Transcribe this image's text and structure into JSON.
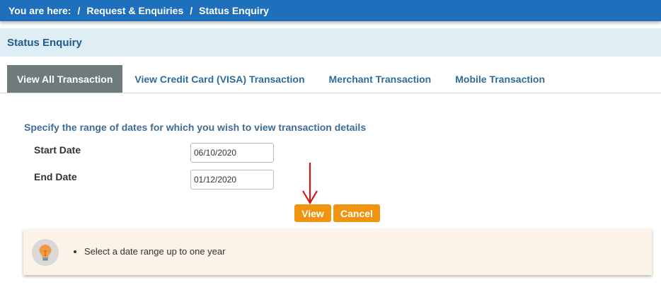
{
  "breadcrumb": {
    "prefix": "You are here:",
    "separator": "/",
    "items": [
      "Request & Enquiries",
      "Status Enquiry"
    ]
  },
  "section": {
    "title": "Status Enquiry"
  },
  "tabs": [
    {
      "label": "View All Transaction",
      "active": true
    },
    {
      "label": "View Credit Card (VISA) Transaction",
      "active": false
    },
    {
      "label": "Merchant Transaction",
      "active": false
    },
    {
      "label": "Mobile Transaction",
      "active": false
    }
  ],
  "form": {
    "instructions": "Specify the range of dates for which you wish to view transaction details",
    "start_date": {
      "label": "Start Date",
      "value": "06/10/2020"
    },
    "end_date": {
      "label": "End Date",
      "value": "01/12/2020"
    },
    "view_label": "View",
    "cancel_label": "Cancel"
  },
  "tip": {
    "icon": "lightbulb-icon",
    "items": [
      "Select a date range up to one year"
    ]
  },
  "colors": {
    "topbar": "#1f70bc",
    "header_bg": "#deeef4",
    "active_tab": "#6f7a7a",
    "button": "#f0930f",
    "arrow": "#d0141b",
    "tip_bg": "#fbf2e8"
  }
}
